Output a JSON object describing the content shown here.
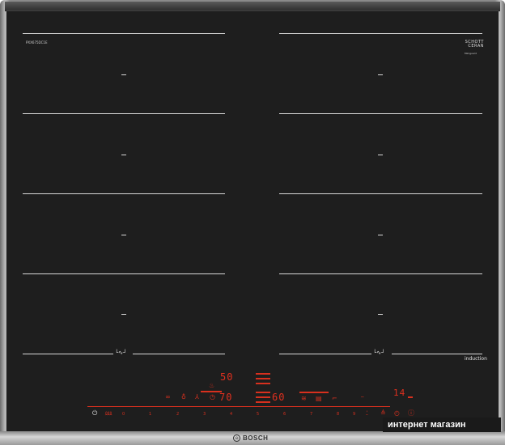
{
  "product": {
    "model_code": "PXX675DC1E",
    "brand_glass": "SCHOTT\nCERAN",
    "brand_glass_sub": "Miniguard",
    "induction_label": "induction",
    "brand": "BOSCH"
  },
  "zones": {
    "flex_symbol": "└∿┘",
    "dash": "—"
  },
  "display": {
    "upper_value": "50",
    "main_value": "70",
    "right_value": "60",
    "timer_value": "14"
  },
  "controls": {
    "power_icon": "⏻",
    "scale": [
      "0",
      "1",
      "2",
      "3",
      "4",
      "5",
      "6",
      "7",
      "8",
      "9"
    ]
  },
  "watermark": "интернет магазин"
}
